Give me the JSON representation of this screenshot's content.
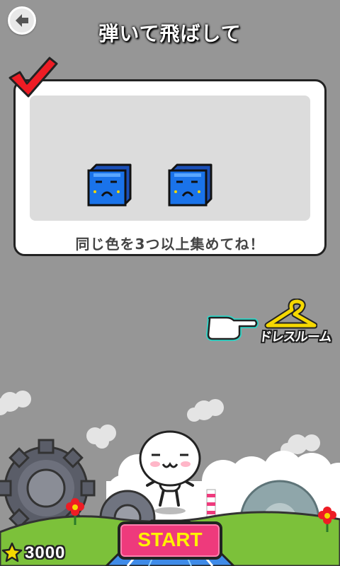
{
  "header": {
    "title": "弾いて飛ばして",
    "back_icon": "back-arrow-icon"
  },
  "tutorial": {
    "instruction": "同じ色を3つ以上集めてね！",
    "check_color": "#ee1c24",
    "block_color": "#1a73ea"
  },
  "dressroom": {
    "label": "ドレスルーム",
    "hanger_color": "#f5d800"
  },
  "footer": {
    "start_label": "START",
    "coin_count": "3000"
  },
  "colors": {
    "background": "#969696",
    "start_button": "#ee3a7c",
    "start_text": "#fff200"
  }
}
